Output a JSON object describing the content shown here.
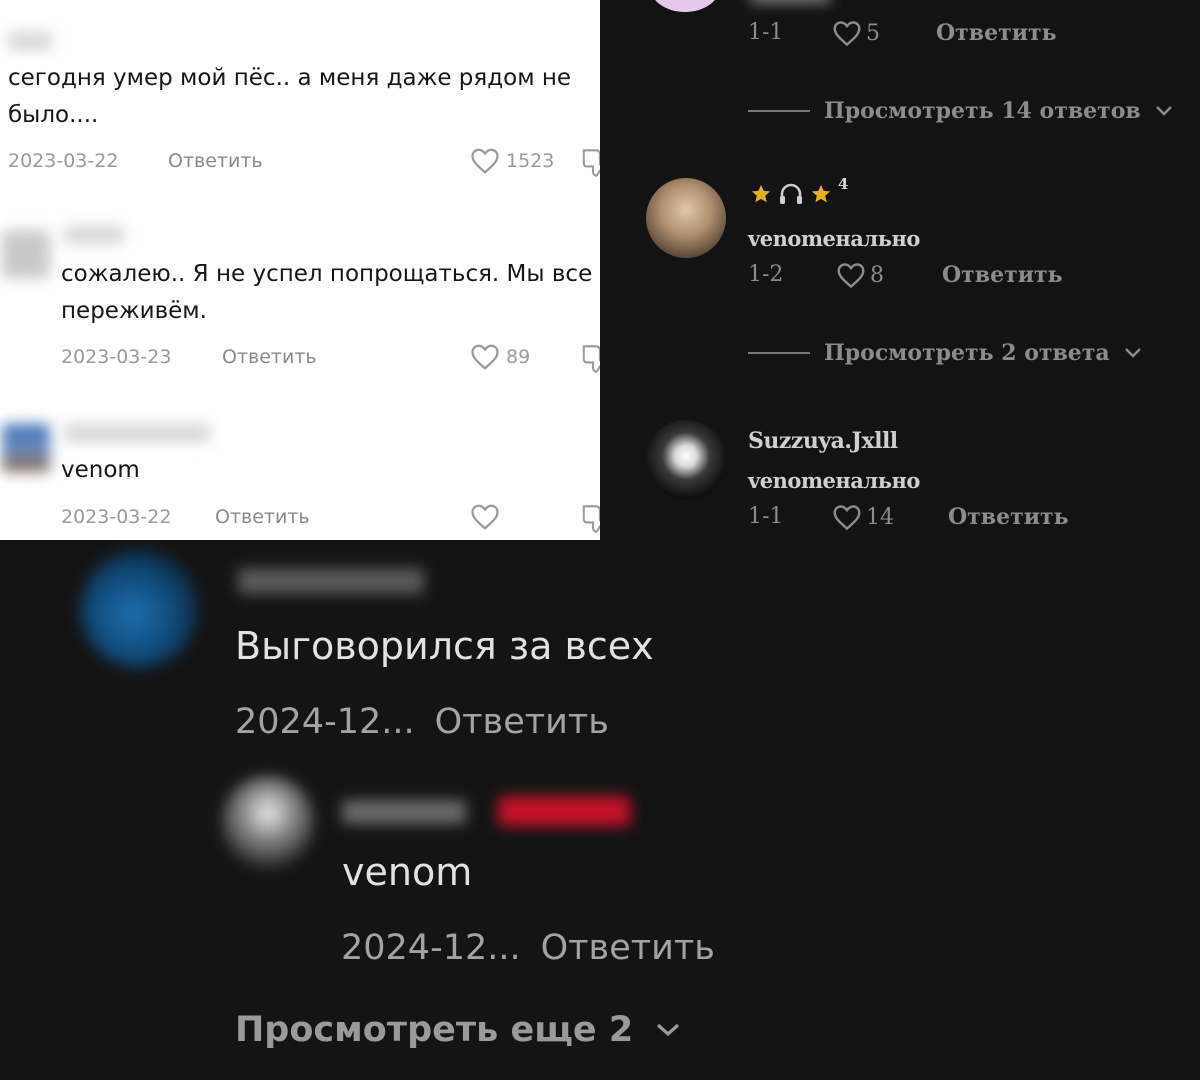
{
  "panel_light": {
    "comments": [
      {
        "text": "сегодня умер мой пёс.. а меня даже рядом не было....",
        "date": "2023-03-22",
        "reply": "Ответить",
        "likes": "1523"
      },
      {
        "text": "сожалею.. Я не успел попрощаться. Мы все переживём.",
        "date": "2023-03-23",
        "reply": "Ответить",
        "likes": "89"
      },
      {
        "text": "venom",
        "date": "2023-03-22",
        "reply": "Ответить",
        "likes": ""
      }
    ]
  },
  "panel_dark_right": {
    "top_comment": {
      "time": "1-1",
      "likes": "5",
      "reply": "Ответить"
    },
    "view_replies_1": "Просмотреть 14 ответов",
    "comment_2": {
      "badge_text": "4",
      "text": "venomенально",
      "time": "1-2",
      "likes": "8",
      "reply": "Ответить"
    },
    "view_replies_2": "Просмотреть 2 ответа",
    "comment_3": {
      "username": "Suzzuya.Jxlll",
      "text": "venomенально",
      "time": "1-1",
      "likes": "14",
      "reply": "Ответить"
    }
  },
  "panel_dark_bottom": {
    "comment_1": {
      "text": "Выговорился за всех",
      "date": "2024-12...",
      "reply": "Ответить"
    },
    "comment_2": {
      "text": "venom",
      "date": "2024-12...",
      "reply": "Ответить"
    },
    "view_more": "Просмотреть еще 2"
  },
  "colors": {
    "light_bg": "#ffffff",
    "dark_bg": "#131313",
    "star_gold": "#e6b01c",
    "blurred_red_tag": "#c4122a"
  }
}
